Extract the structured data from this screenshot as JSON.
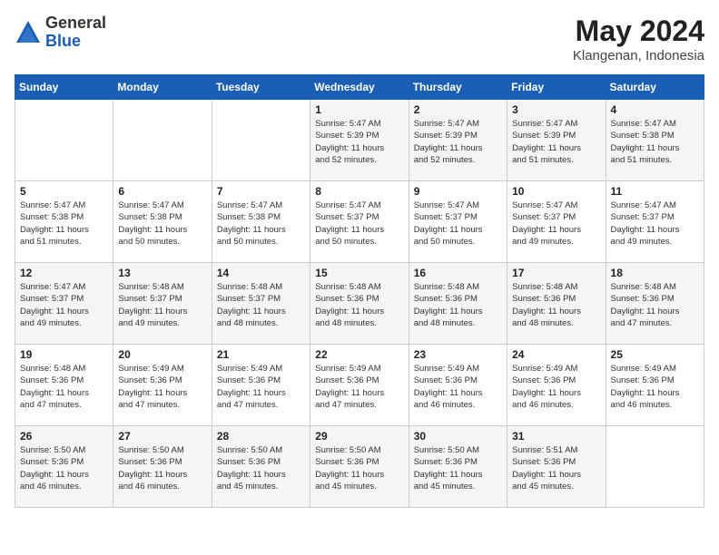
{
  "header": {
    "logo_general": "General",
    "logo_blue": "Blue",
    "month_year": "May 2024",
    "location": "Klangenan, Indonesia"
  },
  "days_of_week": [
    "Sunday",
    "Monday",
    "Tuesday",
    "Wednesday",
    "Thursday",
    "Friday",
    "Saturday"
  ],
  "weeks": [
    [
      {
        "day": "",
        "info": ""
      },
      {
        "day": "",
        "info": ""
      },
      {
        "day": "",
        "info": ""
      },
      {
        "day": "1",
        "info": "Sunrise: 5:47 AM\nSunset: 5:39 PM\nDaylight: 11 hours\nand 52 minutes."
      },
      {
        "day": "2",
        "info": "Sunrise: 5:47 AM\nSunset: 5:39 PM\nDaylight: 11 hours\nand 52 minutes."
      },
      {
        "day": "3",
        "info": "Sunrise: 5:47 AM\nSunset: 5:39 PM\nDaylight: 11 hours\nand 51 minutes."
      },
      {
        "day": "4",
        "info": "Sunrise: 5:47 AM\nSunset: 5:38 PM\nDaylight: 11 hours\nand 51 minutes."
      }
    ],
    [
      {
        "day": "5",
        "info": "Sunrise: 5:47 AM\nSunset: 5:38 PM\nDaylight: 11 hours\nand 51 minutes."
      },
      {
        "day": "6",
        "info": "Sunrise: 5:47 AM\nSunset: 5:38 PM\nDaylight: 11 hours\nand 50 minutes."
      },
      {
        "day": "7",
        "info": "Sunrise: 5:47 AM\nSunset: 5:38 PM\nDaylight: 11 hours\nand 50 minutes."
      },
      {
        "day": "8",
        "info": "Sunrise: 5:47 AM\nSunset: 5:37 PM\nDaylight: 11 hours\nand 50 minutes."
      },
      {
        "day": "9",
        "info": "Sunrise: 5:47 AM\nSunset: 5:37 PM\nDaylight: 11 hours\nand 50 minutes."
      },
      {
        "day": "10",
        "info": "Sunrise: 5:47 AM\nSunset: 5:37 PM\nDaylight: 11 hours\nand 49 minutes."
      },
      {
        "day": "11",
        "info": "Sunrise: 5:47 AM\nSunset: 5:37 PM\nDaylight: 11 hours\nand 49 minutes."
      }
    ],
    [
      {
        "day": "12",
        "info": "Sunrise: 5:47 AM\nSunset: 5:37 PM\nDaylight: 11 hours\nand 49 minutes."
      },
      {
        "day": "13",
        "info": "Sunrise: 5:48 AM\nSunset: 5:37 PM\nDaylight: 11 hours\nand 49 minutes."
      },
      {
        "day": "14",
        "info": "Sunrise: 5:48 AM\nSunset: 5:37 PM\nDaylight: 11 hours\nand 48 minutes."
      },
      {
        "day": "15",
        "info": "Sunrise: 5:48 AM\nSunset: 5:36 PM\nDaylight: 11 hours\nand 48 minutes."
      },
      {
        "day": "16",
        "info": "Sunrise: 5:48 AM\nSunset: 5:36 PM\nDaylight: 11 hours\nand 48 minutes."
      },
      {
        "day": "17",
        "info": "Sunrise: 5:48 AM\nSunset: 5:36 PM\nDaylight: 11 hours\nand 48 minutes."
      },
      {
        "day": "18",
        "info": "Sunrise: 5:48 AM\nSunset: 5:36 PM\nDaylight: 11 hours\nand 47 minutes."
      }
    ],
    [
      {
        "day": "19",
        "info": "Sunrise: 5:48 AM\nSunset: 5:36 PM\nDaylight: 11 hours\nand 47 minutes."
      },
      {
        "day": "20",
        "info": "Sunrise: 5:49 AM\nSunset: 5:36 PM\nDaylight: 11 hours\nand 47 minutes."
      },
      {
        "day": "21",
        "info": "Sunrise: 5:49 AM\nSunset: 5:36 PM\nDaylight: 11 hours\nand 47 minutes."
      },
      {
        "day": "22",
        "info": "Sunrise: 5:49 AM\nSunset: 5:36 PM\nDaylight: 11 hours\nand 47 minutes."
      },
      {
        "day": "23",
        "info": "Sunrise: 5:49 AM\nSunset: 5:36 PM\nDaylight: 11 hours\nand 46 minutes."
      },
      {
        "day": "24",
        "info": "Sunrise: 5:49 AM\nSunset: 5:36 PM\nDaylight: 11 hours\nand 46 minutes."
      },
      {
        "day": "25",
        "info": "Sunrise: 5:49 AM\nSunset: 5:36 PM\nDaylight: 11 hours\nand 46 minutes."
      }
    ],
    [
      {
        "day": "26",
        "info": "Sunrise: 5:50 AM\nSunset: 5:36 PM\nDaylight: 11 hours\nand 46 minutes."
      },
      {
        "day": "27",
        "info": "Sunrise: 5:50 AM\nSunset: 5:36 PM\nDaylight: 11 hours\nand 46 minutes."
      },
      {
        "day": "28",
        "info": "Sunrise: 5:50 AM\nSunset: 5:36 PM\nDaylight: 11 hours\nand 45 minutes."
      },
      {
        "day": "29",
        "info": "Sunrise: 5:50 AM\nSunset: 5:36 PM\nDaylight: 11 hours\nand 45 minutes."
      },
      {
        "day": "30",
        "info": "Sunrise: 5:50 AM\nSunset: 5:36 PM\nDaylight: 11 hours\nand 45 minutes."
      },
      {
        "day": "31",
        "info": "Sunrise: 5:51 AM\nSunset: 5:36 PM\nDaylight: 11 hours\nand 45 minutes."
      },
      {
        "day": "",
        "info": ""
      }
    ]
  ]
}
